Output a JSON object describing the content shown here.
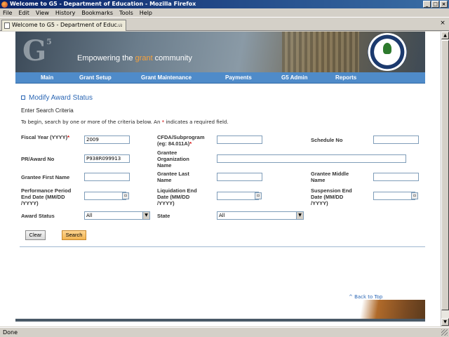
{
  "window": {
    "title": "Welcome to G5 - Department of Education - Mozilla Firefox"
  },
  "menu": [
    "File",
    "Edit",
    "View",
    "History",
    "Bookmarks",
    "Tools",
    "Help"
  ],
  "tab": {
    "label": "Welcome to G5 - Department of Educ..."
  },
  "banner": {
    "logo": "G",
    "logo_sup": "5",
    "tagline_pre": "Empowering the ",
    "tagline_hl": "grant",
    "tagline_post": " community"
  },
  "nav": [
    "Main",
    "Grant Setup",
    "Grant Maintenance",
    "Payments",
    "G5 Admin",
    "Reports"
  ],
  "page": {
    "title": "Modify Award Status",
    "criteria_heading": "Enter Search Criteria",
    "instructions_pre": "To begin, search by one or more of the criteria below. An ",
    "instructions_star": "*",
    "instructions_post": " indicates a required field."
  },
  "fields": {
    "fiscal_year": {
      "label": "Fiscal Year (YYYY)",
      "required": "*",
      "value": "2009"
    },
    "cfda": {
      "label": "CFDA/Subprogram (eg: 84.011A)",
      "required": "*",
      "value": ""
    },
    "schedule_no": {
      "label": "Schedule No",
      "value": ""
    },
    "pr_award_no": {
      "label": "PR/Award No",
      "value": "P938R099913"
    },
    "grantee_org": {
      "label": "Grantee Organization Name",
      "value": ""
    },
    "grantee_first": {
      "label": "Grantee First Name",
      "value": ""
    },
    "grantee_last": {
      "label": "Grantee Last Name",
      "value": ""
    },
    "grantee_middle": {
      "label": "Grantee Middle Name",
      "value": ""
    },
    "perf_end": {
      "label": "Performance Period End Date (MM/DD /YYYY)",
      "value": ""
    },
    "liq_end": {
      "label": "Liquidation End Date (MM/DD /YYYY)",
      "value": ""
    },
    "susp_end": {
      "label": "Suspension End Date (MM/DD /YYYY)",
      "value": ""
    },
    "award_status": {
      "label": "Award Status",
      "value": "All"
    },
    "state": {
      "label": "State",
      "value": "All"
    }
  },
  "buttons": {
    "clear": "Clear",
    "search": "Search"
  },
  "back_to_top": "^ Back to Top",
  "status": "Done"
}
